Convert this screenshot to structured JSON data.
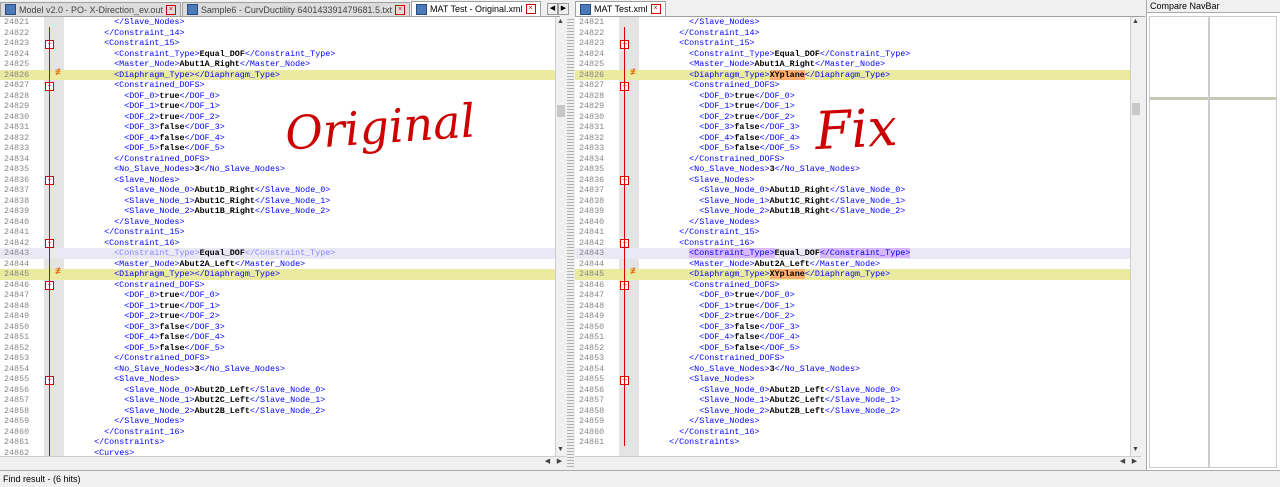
{
  "left_tabs": [
    {
      "label": "Model v2.0 - PO- X-Direction_ev.out",
      "active": false
    },
    {
      "label": "Sample6 - CurvDuctility 640143391479681.5.txt",
      "active": false
    },
    {
      "label": "MAT Test - Original.xml",
      "active": true
    }
  ],
  "right_tabs": [
    {
      "label": "MAT Test.xml",
      "active": true
    }
  ],
  "navbar_title": "Compare NavBar",
  "status_text": "Find result - (6 hits)",
  "annotations": {
    "left": "Original",
    "right": "Fix"
  },
  "left_lines": [
    {
      "n": "24821",
      "t": "      </Slave_Nodes>"
    },
    {
      "n": "24822",
      "t": "    </Constraint_14>"
    },
    {
      "n": "24823",
      "t": "    <Constraint_15>"
    },
    {
      "n": "24824",
      "t": "      <Constraint_Type>Equal_DOF</Constraint_Type>"
    },
    {
      "n": "24825",
      "t": "      <Master_Node>Abut1A_Right</Master_Node>"
    },
    {
      "n": "24826",
      "t": "      <Diaphragm_Type></Diaphragm_Type>"
    },
    {
      "n": "24827",
      "t": "      <Constrained_DOFS>"
    },
    {
      "n": "24828",
      "t": "        <DOF_0>true</DOF_0>"
    },
    {
      "n": "24829",
      "t": "        <DOF_1>true</DOF_1>"
    },
    {
      "n": "24830",
      "t": "        <DOF_2>true</DOF_2>"
    },
    {
      "n": "24831",
      "t": "        <DOF_3>false</DOF_3>"
    },
    {
      "n": "24832",
      "t": "        <DOF_4>false</DOF_4>"
    },
    {
      "n": "24833",
      "t": "        <DOF_5>false</DOF_5>"
    },
    {
      "n": "24834",
      "t": "      </Constrained_DOFS>"
    },
    {
      "n": "24835",
      "t": "      <No_Slave_Nodes>3</No_Slave_Nodes>"
    },
    {
      "n": "24836",
      "t": "      <Slave_Nodes>"
    },
    {
      "n": "24837",
      "t": "        <Slave_Node_0>Abut1D_Right</Slave_Node_0>"
    },
    {
      "n": "24838",
      "t": "        <Slave_Node_1>Abut1C_Right</Slave_Node_1>"
    },
    {
      "n": "24839",
      "t": "        <Slave_Node_2>Abut1B_Right</Slave_Node_2>"
    },
    {
      "n": "24840",
      "t": "      </Slave_Nodes>"
    },
    {
      "n": "24841",
      "t": "    </Constraint_15>"
    },
    {
      "n": "24842",
      "t": "    <Constraint_16>"
    },
    {
      "n": "24843",
      "t": "      <Constraint_Type>Equal_DOF</Constraint_Type>"
    },
    {
      "n": "24844",
      "t": "      <Master_Node>Abut2A_Left</Master_Node>"
    },
    {
      "n": "24845",
      "t": "      <Diaphragm_Type></Diaphragm_Type>"
    },
    {
      "n": "24846",
      "t": "      <Constrained_DOFS>"
    },
    {
      "n": "24847",
      "t": "        <DOF_0>true</DOF_0>"
    },
    {
      "n": "24848",
      "t": "        <DOF_1>true</DOF_1>"
    },
    {
      "n": "24849",
      "t": "        <DOF_2>true</DOF_2>"
    },
    {
      "n": "24850",
      "t": "        <DOF_3>false</DOF_3>"
    },
    {
      "n": "24851",
      "t": "        <DOF_4>false</DOF_4>"
    },
    {
      "n": "24852",
      "t": "        <DOF_5>false</DOF_5>"
    },
    {
      "n": "24853",
      "t": "      </Constrained_DOFS>"
    },
    {
      "n": "24854",
      "t": "      <No_Slave_Nodes>3</No_Slave_Nodes>"
    },
    {
      "n": "24855",
      "t": "      <Slave_Nodes>"
    },
    {
      "n": "24856",
      "t": "        <Slave_Node_0>Abut2D_Left</Slave_Node_0>"
    },
    {
      "n": "24857",
      "t": "        <Slave_Node_1>Abut2C_Left</Slave_Node_1>"
    },
    {
      "n": "24858",
      "t": "        <Slave_Node_2>Abut2B_Left</Slave_Node_2>"
    },
    {
      "n": "24859",
      "t": "      </Slave_Nodes>"
    },
    {
      "n": "24860",
      "t": "    </Constraint_16>"
    },
    {
      "n": "24861",
      "t": "  </Constraints>"
    },
    {
      "n": "24862",
      "t": "  <Curves>"
    }
  ],
  "right_lines": [
    {
      "n": "24821",
      "t": "      </Slave_Nodes>"
    },
    {
      "n": "24822",
      "t": "    </Constraint_14>"
    },
    {
      "n": "24823",
      "t": "    <Constraint_15>"
    },
    {
      "n": "24824",
      "t": "      <Constraint_Type>Equal_DOF</Constraint_Type>"
    },
    {
      "n": "24825",
      "t": "      <Master_Node>Abut1A_Right</Master_Node>"
    },
    {
      "n": "24826",
      "t": "      <Diaphragm_Type>XYplane</Diaphragm_Type>"
    },
    {
      "n": "24827",
      "t": "      <Constrained_DOFS>"
    },
    {
      "n": "24828",
      "t": "        <DOF_0>true</DOF_0>"
    },
    {
      "n": "24829",
      "t": "        <DOF_1>true</DOF_1>"
    },
    {
      "n": "24830",
      "t": "        <DOF_2>true</DOF_2>"
    },
    {
      "n": "24831",
      "t": "        <DOF_3>false</DOF_3>"
    },
    {
      "n": "24832",
      "t": "        <DOF_4>false</DOF_4>"
    },
    {
      "n": "24833",
      "t": "        <DOF_5>false</DOF_5>"
    },
    {
      "n": "24834",
      "t": "      </Constrained_DOFS>"
    },
    {
      "n": "24835",
      "t": "      <No_Slave_Nodes>3</No_Slave_Nodes>"
    },
    {
      "n": "24836",
      "t": "      <Slave_Nodes>"
    },
    {
      "n": "24837",
      "t": "        <Slave_Node_0>Abut1D_Right</Slave_Node_0>"
    },
    {
      "n": "24838",
      "t": "        <Slave_Node_1>Abut1C_Right</Slave_Node_1>"
    },
    {
      "n": "24839",
      "t": "        <Slave_Node_2>Abut1B_Right</Slave_Node_2>"
    },
    {
      "n": "24840",
      "t": "      </Slave_Nodes>"
    },
    {
      "n": "24841",
      "t": "    </Constraint_15>"
    },
    {
      "n": "24842",
      "t": "    <Constraint_16>"
    },
    {
      "n": "24843",
      "t": "      <Constraint_Type>Equal_DOF</Constraint_Type>"
    },
    {
      "n": "24844",
      "t": "      <Master_Node>Abut2A_Left</Master_Node>"
    },
    {
      "n": "24845",
      "t": "      <Diaphragm_Type>XYplane</Diaphragm_Type>"
    },
    {
      "n": "24846",
      "t": "      <Constrained_DOFS>"
    },
    {
      "n": "24847",
      "t": "        <DOF_0>true</DOF_0>"
    },
    {
      "n": "24848",
      "t": "        <DOF_1>true</DOF_1>"
    },
    {
      "n": "24849",
      "t": "        <DOF_2>true</DOF_2>"
    },
    {
      "n": "24850",
      "t": "        <DOF_3>false</DOF_3>"
    },
    {
      "n": "24851",
      "t": "        <DOF_4>false</DOF_4>"
    },
    {
      "n": "24852",
      "t": "        <DOF_5>false</DOF_5>"
    },
    {
      "n": "24853",
      "t": "      </Constrained_DOFS>"
    },
    {
      "n": "24854",
      "t": "      <No_Slave_Nodes>3</No_Slave_Nodes>"
    },
    {
      "n": "24855",
      "t": "      <Slave_Nodes>"
    },
    {
      "n": "24856",
      "t": "        <Slave_Node_0>Abut2D_Left</Slave_Node_0>"
    },
    {
      "n": "24857",
      "t": "        <Slave_Node_1>Abut2C_Left</Slave_Node_1>"
    },
    {
      "n": "24858",
      "t": "        <Slave_Node_2>Abut2B_Left</Slave_Node_2>"
    },
    {
      "n": "24859",
      "t": "      </Slave_Nodes>"
    },
    {
      "n": "24860",
      "t": "    </Constraint_16>"
    },
    {
      "n": "24861",
      "t": "  </Constraints>"
    }
  ]
}
